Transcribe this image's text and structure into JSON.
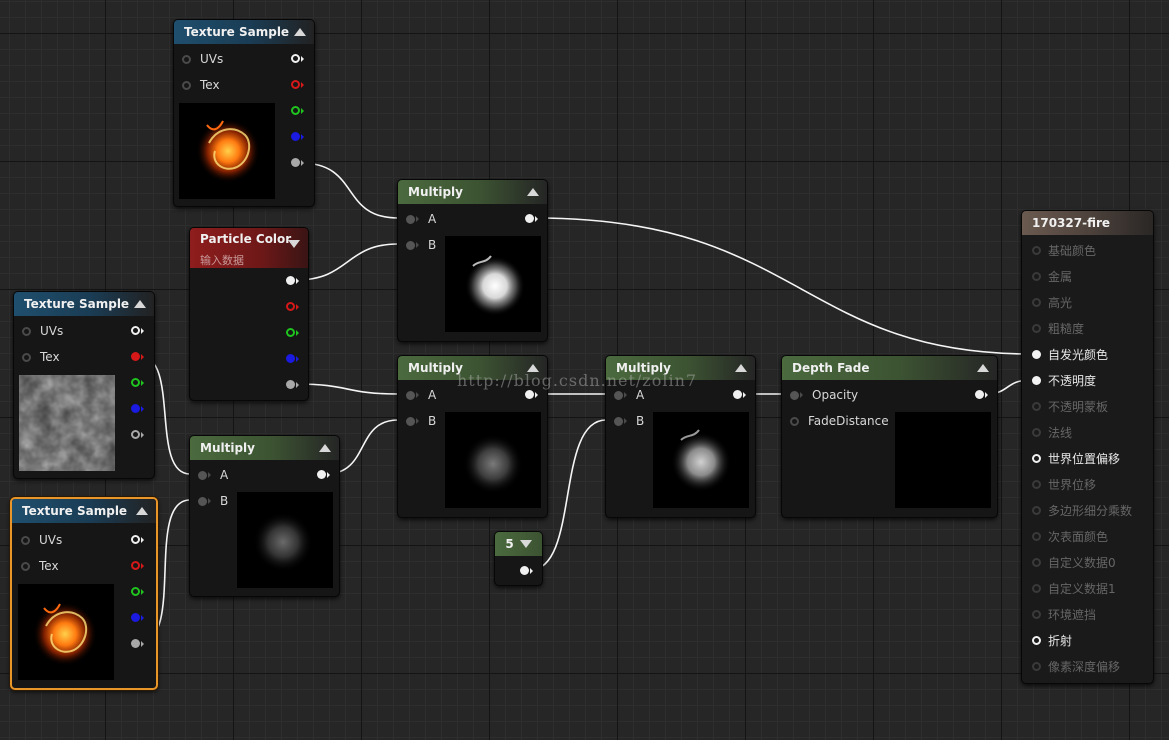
{
  "nodes": {
    "tex_top": {
      "title": "Texture Sample",
      "inputs": [
        "UVs",
        "Tex"
      ]
    },
    "tex_mid": {
      "title": "Texture Sample",
      "inputs": [
        "UVs",
        "Tex"
      ]
    },
    "tex_bot": {
      "title": "Texture Sample",
      "inputs": [
        "UVs",
        "Tex"
      ]
    },
    "particle_color": {
      "title": "Particle Color",
      "subtitle": "输入数据"
    },
    "mul_top": {
      "title": "Multiply",
      "inputs": [
        "A",
        "B"
      ]
    },
    "mul_mid": {
      "title": "Multiply",
      "inputs": [
        "A",
        "B"
      ]
    },
    "mul_left": {
      "title": "Multiply",
      "inputs": [
        "A",
        "B"
      ]
    },
    "mul_right": {
      "title": "Multiply",
      "inputs": [
        "A",
        "B"
      ]
    },
    "const": {
      "title": "5"
    },
    "depth_fade": {
      "title": "Depth Fade",
      "inputs": [
        "Opacity",
        "FadeDistance"
      ]
    }
  },
  "material": {
    "title": "170327-fire",
    "pins": [
      {
        "label": "基础颜色",
        "active": false
      },
      {
        "label": "金属",
        "active": false
      },
      {
        "label": "高光",
        "active": false
      },
      {
        "label": "粗糙度",
        "active": false
      },
      {
        "label": "自发光颜色",
        "active": true,
        "connected": true
      },
      {
        "label": "不透明度",
        "active": true,
        "connected": true
      },
      {
        "label": "不透明蒙板",
        "active": false
      },
      {
        "label": "法线",
        "active": false
      },
      {
        "label": "世界位置偏移",
        "active": true,
        "connected": false
      },
      {
        "label": "世界位移",
        "active": false
      },
      {
        "label": "多边形细分乘数",
        "active": false
      },
      {
        "label": "次表面颜色",
        "active": false
      },
      {
        "label": "自定义数据0",
        "active": false
      },
      {
        "label": "自定义数据1",
        "active": false
      },
      {
        "label": "环境遮挡",
        "active": false
      },
      {
        "label": "折射",
        "active": true,
        "connected": false
      },
      {
        "label": "像素深度偏移",
        "active": false
      }
    ]
  },
  "pin_colors": {
    "rgba": "#f0f0f0",
    "r": "#d61818",
    "g": "#1fc41f",
    "b": "#1a1ae0",
    "a": "#a8a8a8",
    "wire": "#f5f5f5"
  },
  "watermark": "http://blog.csdn.net/zolin7"
}
